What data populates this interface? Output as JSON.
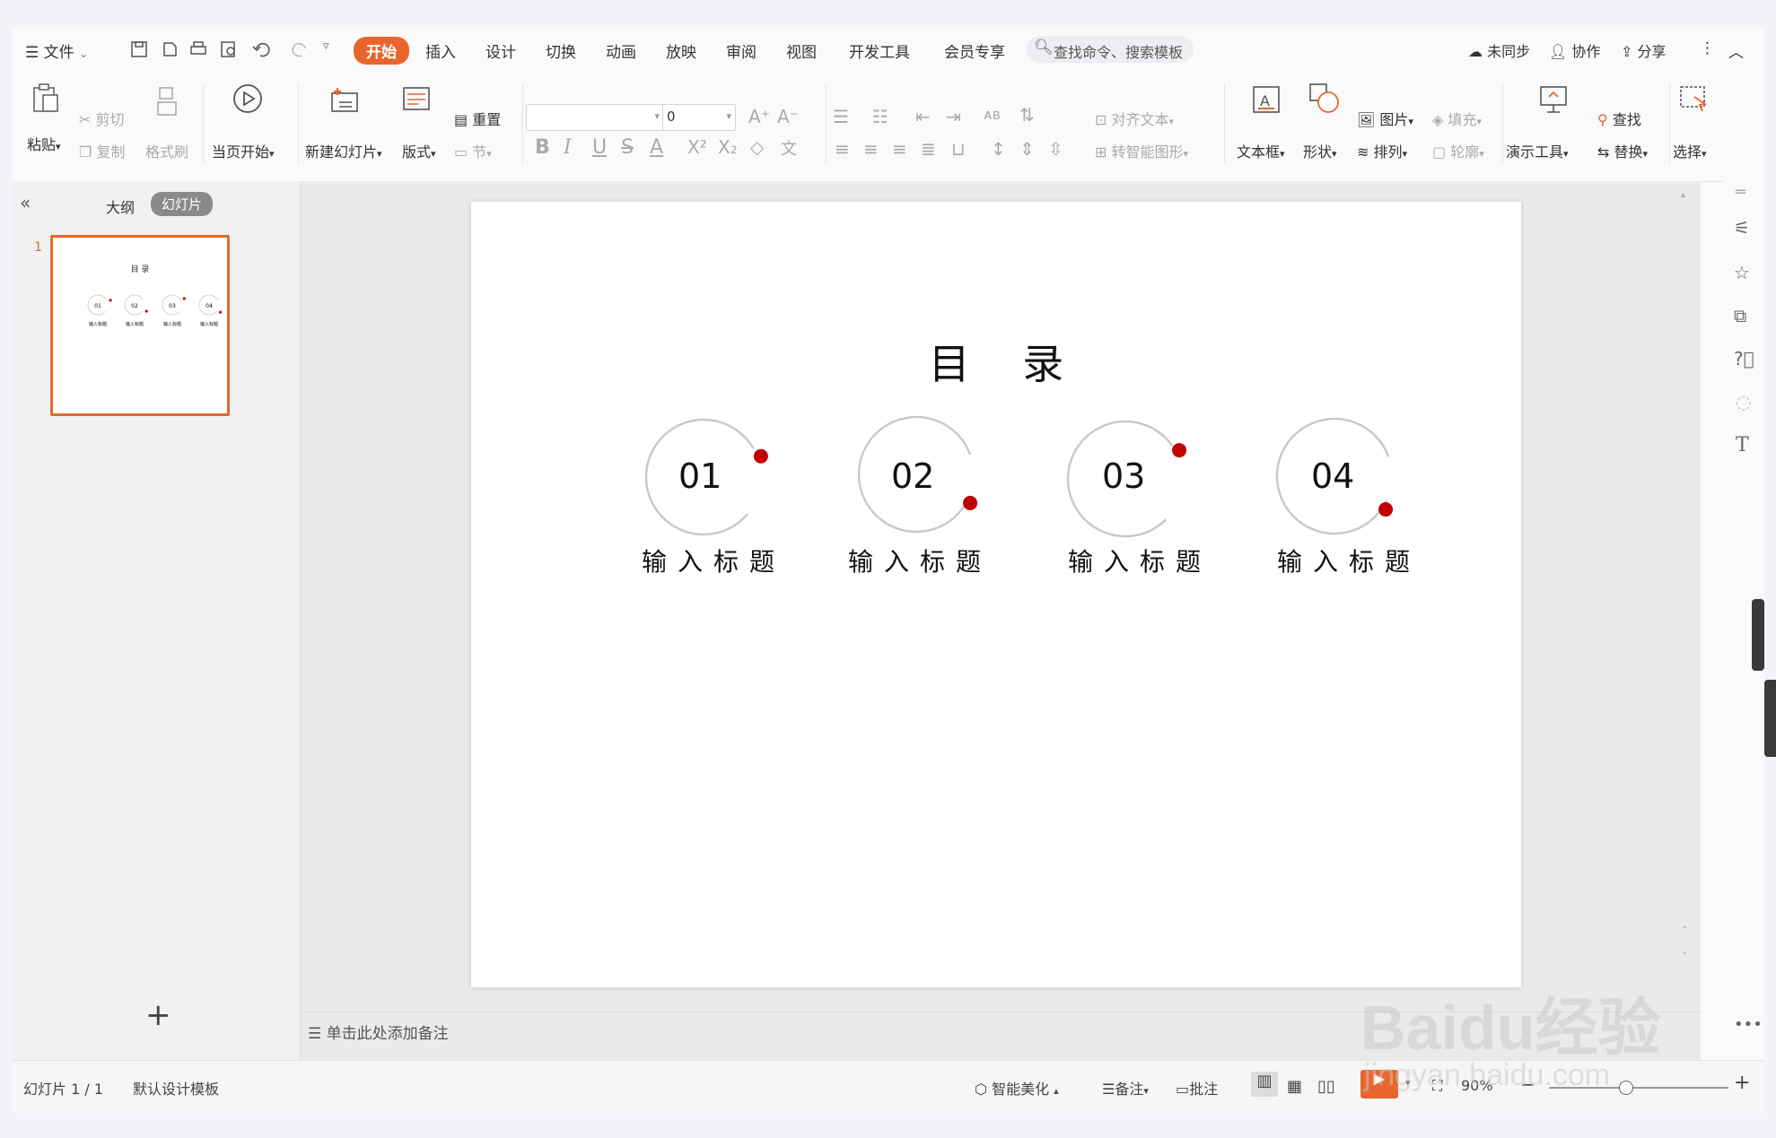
{
  "menu": {
    "file": "文件",
    "tabs": [
      "开始",
      "插入",
      "设计",
      "切换",
      "动画",
      "放映",
      "审阅",
      "视图",
      "开发工具",
      "会员专享"
    ],
    "active_tab": "开始",
    "search_placeholder": "查找命令、搜索模板",
    "sync": "未同步",
    "collab": "协作",
    "share": "分享"
  },
  "ribbon": {
    "paste": "粘贴",
    "cut": "剪切",
    "copy": "复制",
    "format_painter": "格式刷",
    "play_from_current": "当页开始",
    "new_slide": "新建幻灯片",
    "layout": "版式",
    "reset": "重置",
    "section": "节",
    "font_size": "0",
    "align_text": "对齐文本",
    "smartart": "转智能图形",
    "textbox": "文本框",
    "shape": "形状",
    "picture": "图片",
    "arrange": "排列",
    "fill": "填充",
    "outline": "轮廓",
    "present_tools": "演示工具",
    "find": "查找",
    "replace": "替换",
    "select": "选择"
  },
  "panel": {
    "outline_tab": "大纲",
    "slides_tab": "幻灯片",
    "slide_number": "1",
    "add": "+"
  },
  "slide": {
    "title": "目    录",
    "items": [
      {
        "num": "01",
        "label": "输入标题"
      },
      {
        "num": "02",
        "label": "输入标题"
      },
      {
        "num": "03",
        "label": "输入标题"
      },
      {
        "num": "04",
        "label": "输入标题"
      }
    ],
    "accent_color": "#c00000"
  },
  "notes_placeholder": "单击此处添加备注",
  "status": {
    "slide_count": "幻灯片 1 / 1",
    "template": "默认设计模板",
    "beautify": "智能美化",
    "notes": "备注",
    "comments": "批注",
    "zoom": "90%"
  },
  "watermark": {
    "brand": "Baidu经验",
    "url": "jingyan.baidu.com"
  }
}
